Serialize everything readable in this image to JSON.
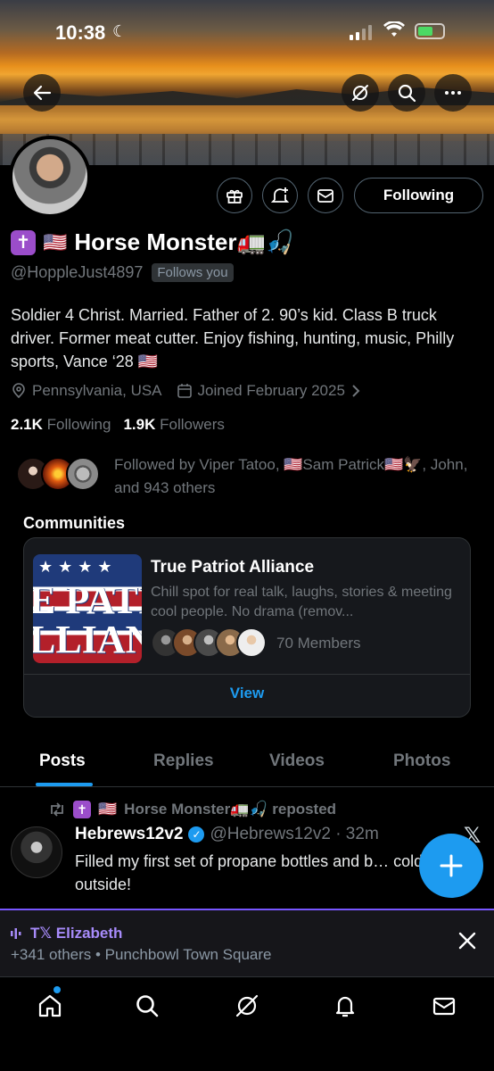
{
  "status": {
    "time": "10:38"
  },
  "banner": {
    "alt": ""
  },
  "profile": {
    "display_name": "Horse Monster🚛🎣",
    "flag": "🇺🇸",
    "cross": "✝",
    "handle": "@HoppleJust4897",
    "follows_you": "Follows you",
    "bio": "Soldier 4 Christ. Married. Father of 2. 90’s kid. Class B truck driver. Former meat cutter. Enjoy fishing, hunting, music, Philly sports, Vance ‘28 🇺🇸",
    "location": "Pennsylvania, USA",
    "joined": "Joined February 2025",
    "following_count": "2.1K",
    "following_label": "Following",
    "followers_count": "1.9K",
    "followers_label": "Followers",
    "follow_button": "Following",
    "followed_by": "Followed by Viper Tatoo, 🇺🇸Sam Patrick🇺🇸🦅, John, and 943 others"
  },
  "communities": {
    "title": "Communities",
    "card": {
      "image_text": "E PATI LLIANC",
      "name": "True Patriot Alliance",
      "description": "Chill spot for real talk, laughs, stories & meeting cool people. No drama (remov...",
      "members": "70 Members",
      "view": "View"
    }
  },
  "tabs": [
    "Posts",
    "Replies",
    "Videos",
    "Photos"
  ],
  "post": {
    "repost_label": "Horse Monster🚛🎣 reposted",
    "author": "Hebrews12v2",
    "handle_time": "@Hebrews12v2 · 32m",
    "text": "Filled my first set of propane bottles and b… cold outside!"
  },
  "spaces": {
    "title": "T𝕏 Elizabeth",
    "subtitle": "+341 others • Punchbowl Town Square"
  },
  "colors": {
    "accent": "#1d9bf0",
    "spaces": "#7856ff",
    "badge": "#9b4dca"
  }
}
